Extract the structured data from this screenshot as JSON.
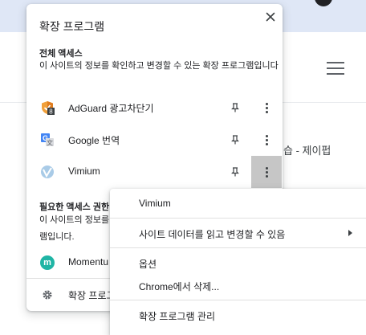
{
  "background": {
    "menu_icon": "hamburger-menu-icon",
    "partial_text": "습 - 제이펍"
  },
  "panel": {
    "title": "확장 프로그램",
    "close_icon": "close-icon",
    "full_access": {
      "title": "전체 액세스",
      "description": "이 사이트의 정보를 확인하고 변경할 수 있는 확장 프로그램입니다"
    },
    "extensions_full": [
      {
        "name": "AdGuard 광고차단기",
        "icon": "adguard-shield-icon",
        "badge": "8"
      },
      {
        "name": "Google 번역",
        "icon": "google-translate-icon"
      },
      {
        "name": "Vimium",
        "icon": "vimium-icon"
      }
    ],
    "access_requested": {
      "title": "필요한 액세스 권한",
      "description_line1": "이 사이트의 정보를",
      "description_line2": "램입니다."
    },
    "extensions_requested": [
      {
        "name": "Momentu",
        "icon": "momentum-icon",
        "letter": "m"
      }
    ],
    "footer": {
      "label": "확장 프로그",
      "icon": "gear-icon"
    }
  },
  "context_menu": {
    "items": [
      {
        "label": "Vimium"
      },
      {
        "label": "사이트 데이터를 읽고 변경할 수 있음",
        "submenu": true
      },
      {
        "label": "옵션"
      },
      {
        "label": "Chrome에서 삭제..."
      },
      {
        "label": "확장 프로그램 관리"
      }
    ]
  },
  "colors": {
    "top_band": "#dfe7f6",
    "active_more_button": "#c6c6c6",
    "momentum": "#1fb5a5",
    "adguard_orange": "#f1a03a"
  }
}
